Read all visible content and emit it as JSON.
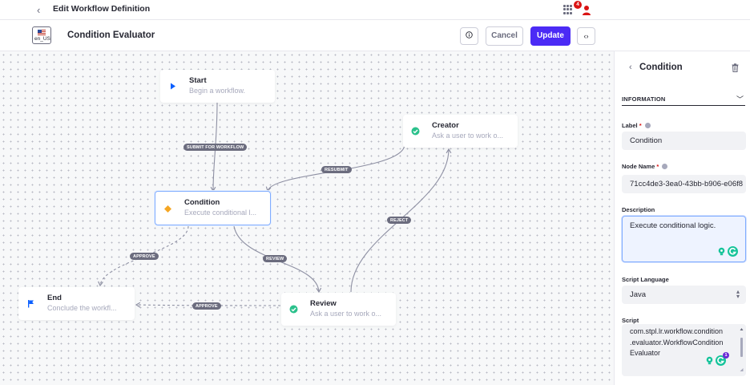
{
  "topbar": {
    "back_icon": "chevron-left-icon",
    "title": "Edit Workflow Definition",
    "notification_count": "4"
  },
  "header": {
    "locale": "en_US",
    "title": "Condition Evaluator",
    "cancel_label": "Cancel",
    "update_label": "Update",
    "accent_color": "#4b2bf5"
  },
  "canvas": {
    "nodes": {
      "start": {
        "title": "Start",
        "desc": "Begin a workflow."
      },
      "creator": {
        "title": "Creator",
        "desc": "Ask a user to work o..."
      },
      "condition": {
        "title": "Condition",
        "desc": "Execute conditional l..."
      },
      "end": {
        "title": "End",
        "desc": "Conclude the workfl..."
      },
      "review": {
        "title": "Review",
        "desc": "Ask a user to work o..."
      }
    },
    "edges": {
      "submit": "SUBMIT FOR WORKFLOW",
      "resubmit": "RESUBMIT",
      "reject": "REJECT",
      "approve_condition": "APPROVE",
      "review": "REVIEW",
      "approve_review": "APPROVE"
    }
  },
  "panel": {
    "title": "Condition",
    "section": "INFORMATION",
    "label_field": {
      "label": "Label",
      "required": "*",
      "value": "Condition"
    },
    "node_name_field": {
      "label": "Node Name",
      "required": "*",
      "value": "71cc4de3-3ea0-43bb-b906-e06f8"
    },
    "description_field": {
      "label": "Description",
      "value": "Execute conditional logic."
    },
    "script_language_field": {
      "label": "Script Language",
      "value": "Java"
    },
    "script_field": {
      "label": "Script",
      "lines": [
        "com.stpl.lr.workflow.condition",
        ".evaluator.WorkflowCondition",
        "Evaluator"
      ],
      "badge_count": "1"
    }
  }
}
